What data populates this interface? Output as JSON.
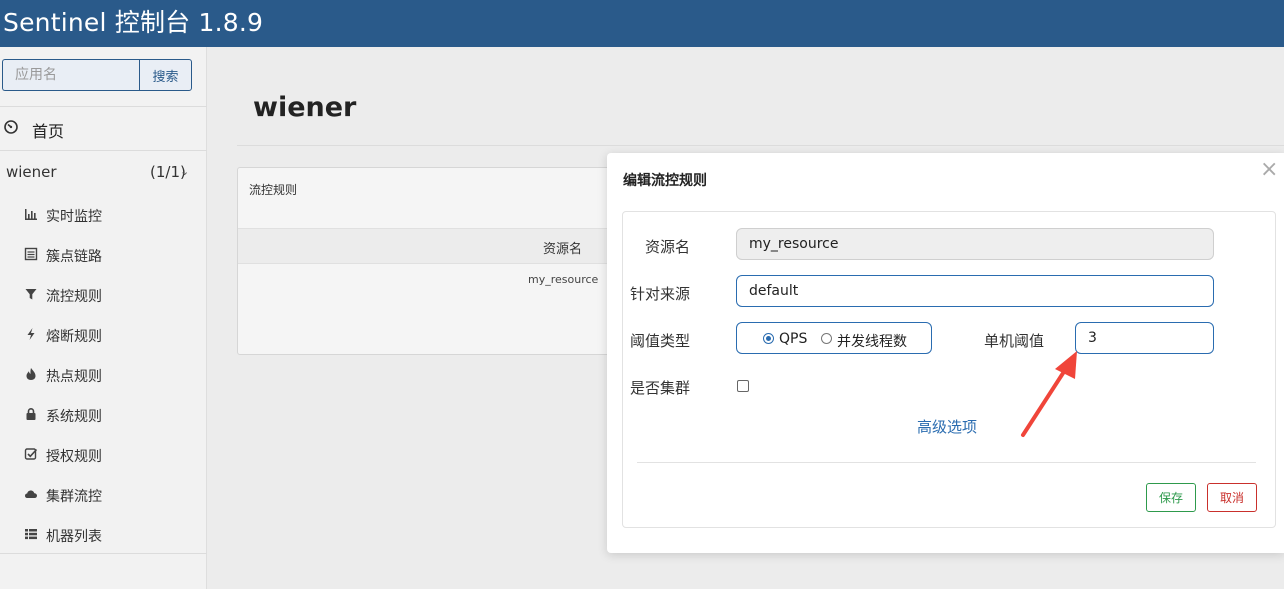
{
  "header": {
    "title": "Sentinel 控制台 1.8.9"
  },
  "sidebar": {
    "search": {
      "placeholder": "应用名",
      "button_label": "搜索"
    },
    "home_label": "首页",
    "app": {
      "name": "wiener",
      "count": "(1/1)"
    },
    "items": [
      {
        "label": "实时监控",
        "icon": "bar-chart-icon"
      },
      {
        "label": "簇点链路",
        "icon": "list-icon"
      },
      {
        "label": "流控规则",
        "icon": "filter-icon"
      },
      {
        "label": "熔断规则",
        "icon": "flash-icon"
      },
      {
        "label": "热点规则",
        "icon": "fire-icon"
      },
      {
        "label": "系统规则",
        "icon": "lock-icon"
      },
      {
        "label": "授权规则",
        "icon": "check-square-icon"
      },
      {
        "label": "集群流控",
        "icon": "cloud-icon"
      },
      {
        "label": "机器列表",
        "icon": "th-list-icon"
      }
    ]
  },
  "main": {
    "title": "wiener",
    "panel": {
      "heading": "流控规则",
      "column_header": "资源名",
      "rows": [
        {
          "resource": "my_resource"
        }
      ]
    }
  },
  "modal": {
    "title": "编辑流控规则",
    "close": "×",
    "fields": {
      "resource_label": "资源名",
      "resource_value": "my_resource",
      "source_label": "针对来源",
      "source_value": "default",
      "threshold_type_label": "阈值类型",
      "threshold_options": [
        {
          "label": "QPS",
          "checked": true
        },
        {
          "label": "并发线程数",
          "checked": false
        }
      ],
      "single_threshold_label": "单机阈值",
      "single_threshold_value": "3",
      "cluster_label": "是否集群",
      "cluster_checked": false
    },
    "advanced_link": "高级选项",
    "save_label": "保存",
    "cancel_label": "取消"
  },
  "colors": {
    "header_bg": "#2a5a8a",
    "accent": "#2a6cb0",
    "save": "#2e9a4c",
    "cancel": "#c9302c",
    "annotation_arrow": "#f0453a"
  }
}
